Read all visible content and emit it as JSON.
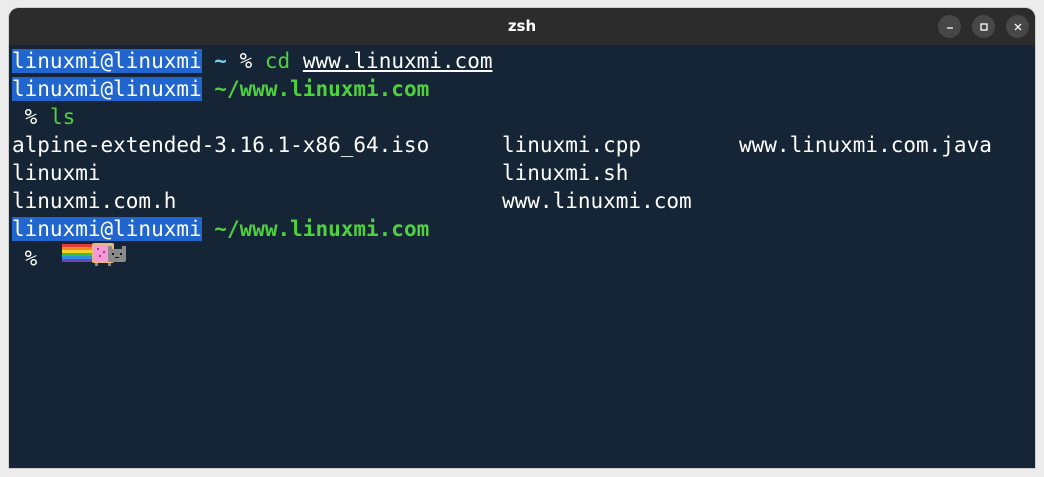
{
  "window": {
    "title": "zsh",
    "minimize_icon": "minimize-icon",
    "maximize_icon": "maximize-icon",
    "close_icon": "close-icon"
  },
  "terminal": {
    "prompt1": {
      "user": "linuxmi@linuxmi",
      "cwd": " ~ ",
      "symbol": "% ",
      "command": "cd",
      "argument": "www.linuxmi.com"
    },
    "prompt2": {
      "user": "linuxmi@linuxmi",
      "cwd": " ~/www.linuxmi.com",
      "symbol": " % ",
      "command": "ls"
    },
    "ls_output": [
      [
        "alpine-extended-3.16.1-x86_64.iso",
        "linuxmi.cpp",
        "www.linuxmi.com.java"
      ],
      [
        "linuxmi",
        "linuxmi.sh",
        ""
      ],
      [
        "linuxmi.com.h",
        "www.linuxmi.com",
        ""
      ]
    ],
    "prompt3": {
      "user": "linuxmi@linuxmi",
      "cwd": " ~/www.linuxmi.com",
      "symbol": " % ",
      "cursor_icon": "nyan-cat-icon"
    }
  },
  "colors": {
    "terminal_bg": "#152536",
    "user_highlight": "#2166cf",
    "path_green": "#4fd13f",
    "tilde_cyan": "#6fd0e6"
  }
}
